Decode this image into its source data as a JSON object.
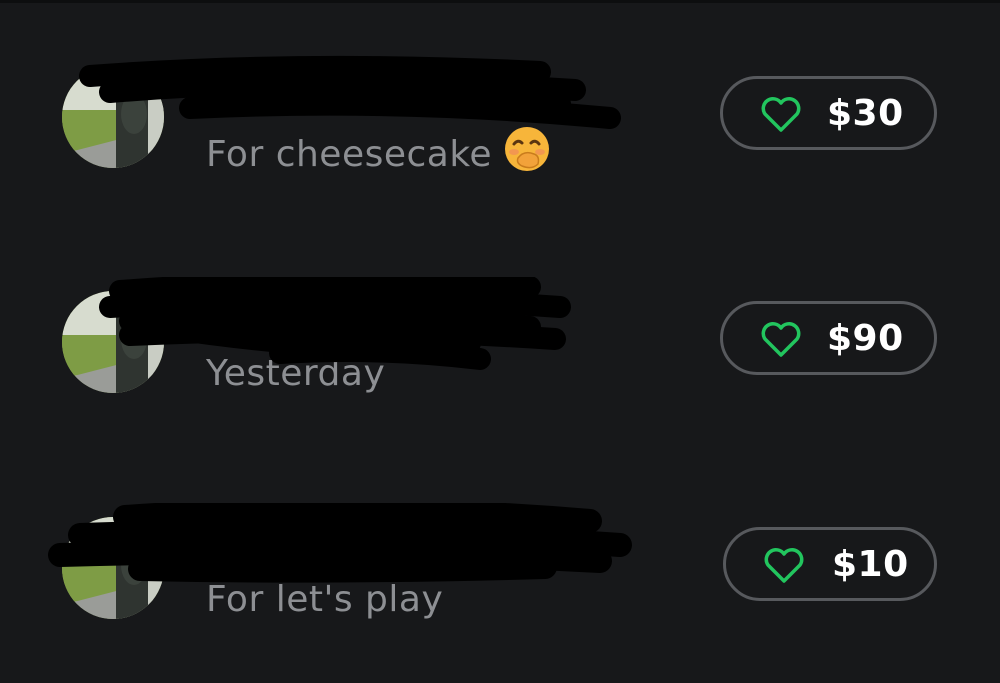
{
  "feed": {
    "items": [
      {
        "avatar_icon": "avatar-photo-icon",
        "title_redacted": true,
        "subtitle": "For cheesecake",
        "subtitle_emoji": "hand-over-mouth-emoji-icon",
        "amount": "$30",
        "like_icon": "heart-outline-icon",
        "like_color": "#22c55e"
      },
      {
        "avatar_icon": "avatar-photo-icon",
        "title_redacted": true,
        "subtitle": "Yesterday",
        "subtitle_emoji": null,
        "amount": "$90",
        "like_icon": "heart-outline-icon",
        "like_color": "#22c55e"
      },
      {
        "avatar_icon": "avatar-photo-icon",
        "title_redacted": true,
        "subtitle": "For let's play",
        "subtitle_emoji": null,
        "amount": "$10",
        "like_icon": "heart-outline-icon",
        "like_color": "#22c55e"
      }
    ]
  },
  "colors": {
    "background": "#17181a",
    "pill_border": "#57595d",
    "subtitle_text": "#8d8f93",
    "amount_text": "#ffffff",
    "heart_accent": "#22c55e",
    "redaction": "#000000"
  }
}
